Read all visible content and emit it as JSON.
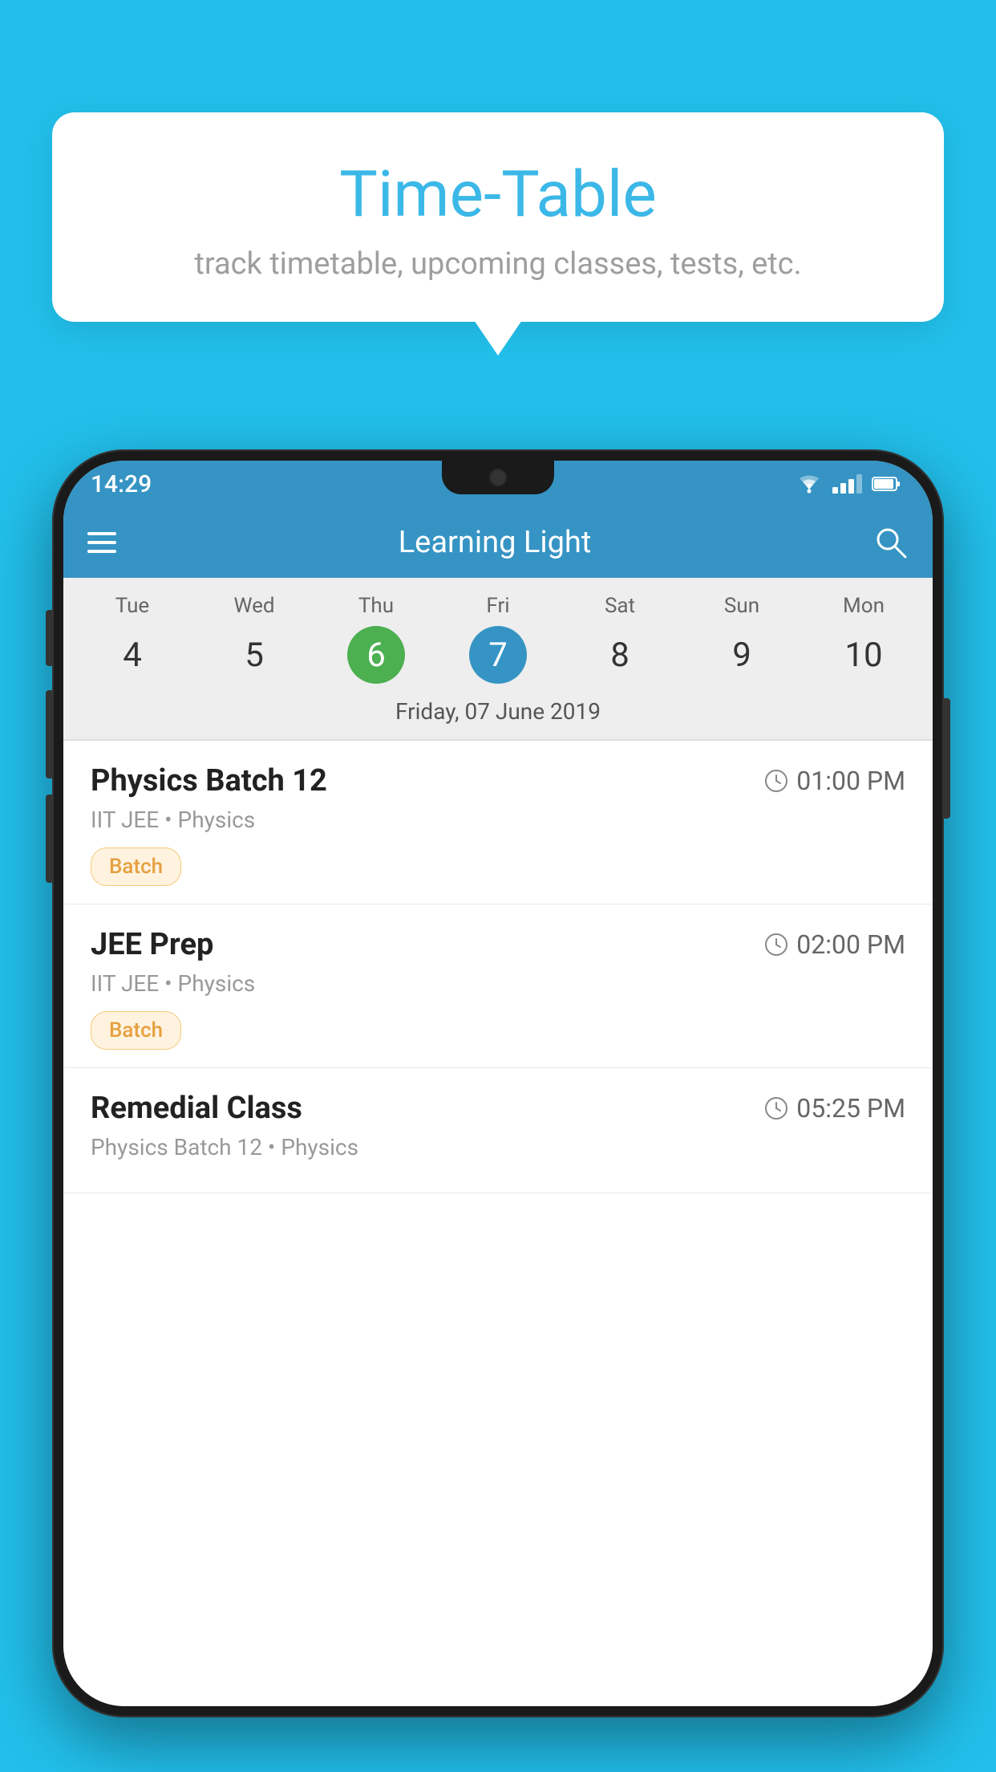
{
  "background_color": "#22BFEA",
  "tooltip": {
    "title": "Time-Table",
    "subtitle": "track timetable, upcoming classes, tests, etc."
  },
  "phone": {
    "status_bar": {
      "time": "14:29",
      "icons": [
        "wifi",
        "signal",
        "battery"
      ]
    },
    "app_bar": {
      "title": "Learning Light",
      "has_hamburger": true,
      "has_search": true
    },
    "calendar": {
      "days": [
        {
          "name": "Tue",
          "number": "4",
          "state": "normal"
        },
        {
          "name": "Wed",
          "number": "5",
          "state": "normal"
        },
        {
          "name": "Thu",
          "number": "6",
          "state": "today"
        },
        {
          "name": "Fri",
          "number": "7",
          "state": "selected"
        },
        {
          "name": "Sat",
          "number": "8",
          "state": "normal"
        },
        {
          "name": "Sun",
          "number": "9",
          "state": "normal"
        },
        {
          "name": "Mon",
          "number": "10",
          "state": "normal"
        }
      ],
      "selected_date_label": "Friday, 07 June 2019"
    },
    "schedule": [
      {
        "class_name": "Physics Batch 12",
        "time": "01:00 PM",
        "meta": "IIT JEE • Physics",
        "tag": "Batch"
      },
      {
        "class_name": "JEE Prep",
        "time": "02:00 PM",
        "meta": "IIT JEE • Physics",
        "tag": "Batch"
      },
      {
        "class_name": "Remedial Class",
        "time": "05:25 PM",
        "meta": "Physics Batch 12 • Physics",
        "tag": null
      }
    ]
  }
}
